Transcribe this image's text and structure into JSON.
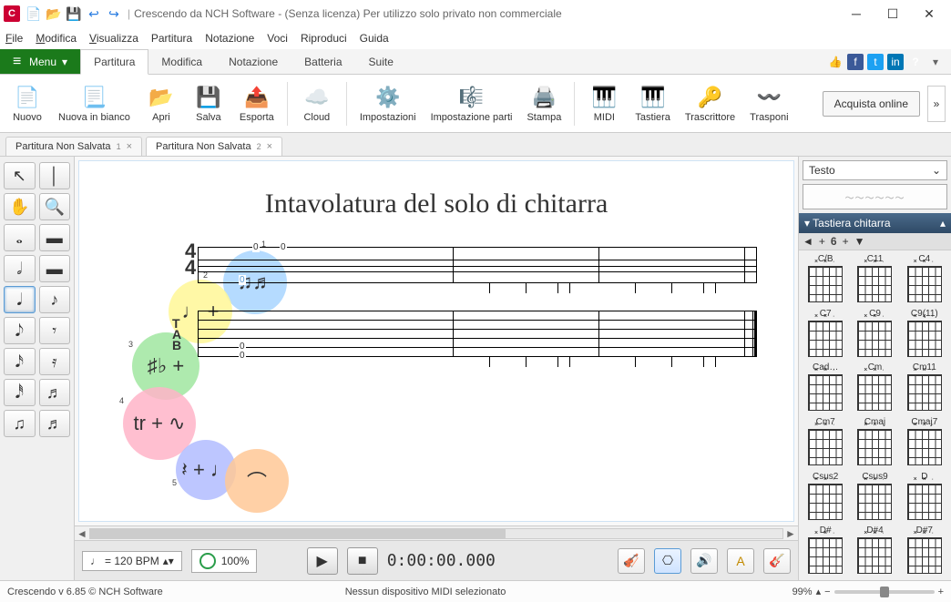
{
  "titlebar": {
    "app_initial": "C",
    "title": "Crescendo da NCH Software - (Senza licenza) Per utilizzo solo privato non commerciale"
  },
  "menubar": [
    "File",
    "Modifica",
    "Visualizza",
    "Partitura",
    "Notazione",
    "Voci",
    "Riproduci",
    "Guida"
  ],
  "menu_button": "Menu",
  "ribbon_tabs": [
    "Partitura",
    "Modifica",
    "Notazione",
    "Batteria",
    "Suite"
  ],
  "active_ribbon_tab": 0,
  "ribbon": {
    "items": [
      {
        "label": "Nuovo",
        "icon": "ico-new"
      },
      {
        "label": "Nuova in bianco",
        "icon": "ico-blank"
      },
      {
        "label": "Apri",
        "icon": "ico-open"
      },
      {
        "label": "Salva",
        "icon": "ico-save"
      },
      {
        "label": "Esporta",
        "icon": "ico-export"
      },
      {
        "label": "Cloud",
        "icon": "ico-cloud"
      },
      {
        "label": "Impostazioni",
        "icon": "ico-settings"
      },
      {
        "label": "Impostazione parti",
        "icon": "ico-parts"
      },
      {
        "label": "Stampa",
        "icon": "ico-print"
      },
      {
        "label": "MIDI",
        "icon": "ico-midi"
      },
      {
        "label": "Tastiera",
        "icon": "ico-keyboard"
      },
      {
        "label": "Trascrittore",
        "icon": "ico-transcribe"
      },
      {
        "label": "Trasponi",
        "icon": "ico-transpose"
      }
    ],
    "separators_after": [
      4,
      5,
      8
    ],
    "buy": "Acquista online"
  },
  "doctabs": [
    {
      "label": "Partitura Non Salvata",
      "index": "1",
      "active": false
    },
    {
      "label": "Partitura Non Salvata",
      "index": "2",
      "active": true
    }
  ],
  "palette_glyphs": [
    "↖",
    "│",
    "✋",
    "🔍",
    "𝅝",
    "▬",
    "𝅗𝅥",
    "▬",
    "𝅘𝅥",
    "♪",
    "𝅘𝅥𝅮",
    "𝄾",
    "𝅘𝅥𝅯",
    "𝄿",
    "𝅘𝅥𝅰",
    "♬",
    "♫",
    "♬"
  ],
  "palette_selected": 8,
  "score": {
    "title": "Intavolatura del solo di chitarra",
    "time_sig_top": "4",
    "time_sig_bottom": "4",
    "tab_label_top": "T\nA\nB",
    "circle_labels": {
      "c1": "♫♬",
      "c2": "♩ +",
      "c3": "♯♭ +",
      "c4": "tr + ∿",
      "c5": "𝄽 + ♩",
      "c6": "⌒"
    },
    "circle_numbers": {
      "n1": "1",
      "n2": "2",
      "n3": "3",
      "n4": "4",
      "n5": "5"
    },
    "staff_zeros": [
      "0",
      "0",
      "0"
    ],
    "tab_zeros": [
      "0",
      "0"
    ]
  },
  "transport": {
    "tempo_note": "♩",
    "tempo": "= 120 BPM",
    "volume": "100%",
    "time": "0:00:00.000"
  },
  "rightpanel": {
    "selector": "Testo",
    "header": "Tastiera chitarra",
    "fret_number": "6",
    "chords": [
      "C/B",
      "C11",
      "C4",
      "C7",
      "C9",
      "C9(11)",
      "Cad…",
      "Cm",
      "Cm11",
      "Cm7",
      "Cmaj",
      "Cmaj7",
      "Csus2",
      "Csus9",
      "D",
      "D#",
      "D#4",
      "D#7"
    ]
  },
  "status": {
    "left": "Crescendo v 6.85 © NCH Software",
    "mid": "Nessun dispositivo MIDI selezionato",
    "zoom": "99%"
  }
}
